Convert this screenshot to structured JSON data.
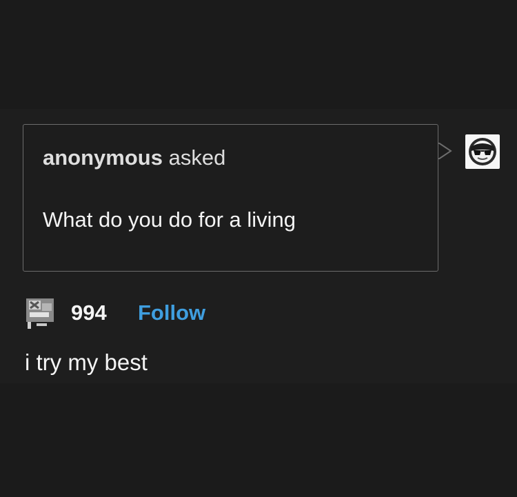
{
  "ask": {
    "asker_name": "anonymous",
    "asked_label": "asked",
    "question": "What do you do for a living"
  },
  "blog": {
    "avatar_icon": "sunglasses-face-icon",
    "reblog_icon": "reblog-icon",
    "note_count": "994",
    "follow_label": "Follow"
  },
  "answer": {
    "text": "i try my best"
  },
  "colors": {
    "background": "#1b1b1b",
    "panel": "#1e1e1e",
    "border": "#6d6d6d",
    "text": "#f3f3f3",
    "link": "#3f9edf"
  }
}
